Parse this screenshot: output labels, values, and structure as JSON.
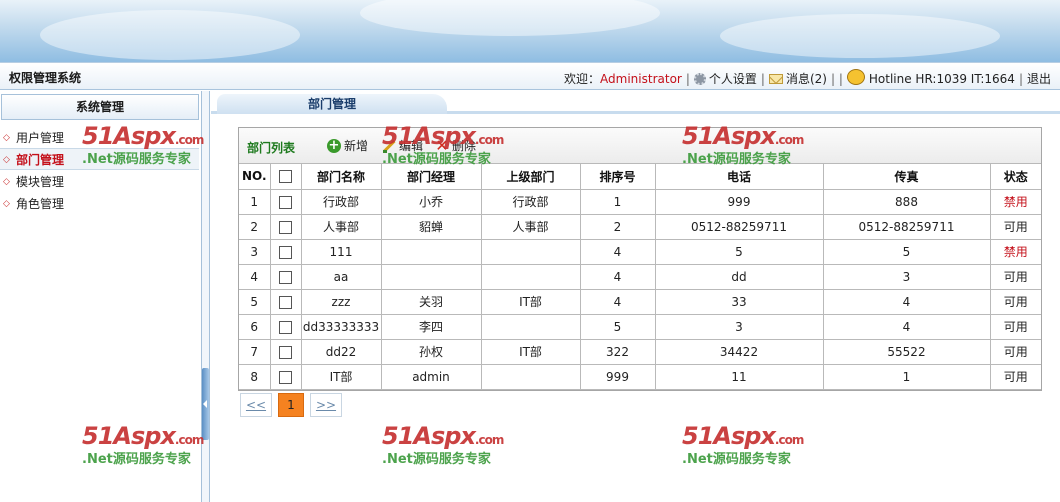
{
  "app": {
    "title": "权限管理系统"
  },
  "userbar": {
    "welcome_prefix": "欢迎：",
    "username": "Administrator",
    "separator": "|",
    "settings_label": "个人设置",
    "messages_label": "消息(2)",
    "extra_separator": "| |",
    "hotline_label": "Hotline HR:1039 IT:1664",
    "logout_label": "退出"
  },
  "sidebar": {
    "heading": "系统管理",
    "items": [
      {
        "label": "用户管理"
      },
      {
        "label": "部门管理"
      },
      {
        "label": "模块管理"
      },
      {
        "label": "角色管理"
      }
    ]
  },
  "tab": {
    "label": "部门管理"
  },
  "grid": {
    "title": "部门列表",
    "add_label": "新增",
    "edit_label": "编辑",
    "delete_label": "删除",
    "columns": [
      "NO.",
      "",
      "部门名称",
      "部门经理",
      "上级部门",
      "排序号",
      "电话",
      "传真",
      "状态"
    ],
    "rows": [
      {
        "no": "1",
        "name": "行政部",
        "manager": "小乔",
        "parent": "行政部",
        "order": "1",
        "phone": "999",
        "fax": "888",
        "status": "禁用"
      },
      {
        "no": "2",
        "name": "人事部",
        "manager": "貂蝉",
        "parent": "人事部",
        "order": "2",
        "phone": "0512-88259711",
        "fax": "0512-88259711",
        "status": "可用"
      },
      {
        "no": "3",
        "name": "111",
        "manager": "",
        "parent": "",
        "order": "4",
        "phone": "5",
        "fax": "5",
        "status": "禁用"
      },
      {
        "no": "4",
        "name": "aa",
        "manager": "",
        "parent": "",
        "order": "4",
        "phone": "dd",
        "fax": "3",
        "status": "可用"
      },
      {
        "no": "5",
        "name": "zzz",
        "manager": "关羽",
        "parent": "IT部",
        "order": "4",
        "phone": "33",
        "fax": "4",
        "status": "可用"
      },
      {
        "no": "6",
        "name": "dd33333333",
        "manager": "李四",
        "parent": "",
        "order": "5",
        "phone": "3",
        "fax": "4",
        "status": "可用"
      },
      {
        "no": "7",
        "name": "dd22",
        "manager": "孙权",
        "parent": "IT部",
        "order": "322",
        "phone": "34422",
        "fax": "55522",
        "status": "可用"
      },
      {
        "no": "8",
        "name": "IT部",
        "manager": "admin",
        "parent": "",
        "order": "999",
        "phone": "11",
        "fax": "1",
        "status": "可用"
      }
    ]
  },
  "pager": {
    "prev_label": "<<",
    "current_page": "1",
    "next_label": ">>"
  },
  "watermark": {
    "logo": "51Aspx",
    "domain": ".com",
    "slogan": ".Net源码服务专家"
  },
  "colors": {
    "accent_red": "#c4101a",
    "title_green": "#1e7a1e",
    "pager_active": "#f58220",
    "border_blue": "#a6c1da"
  }
}
